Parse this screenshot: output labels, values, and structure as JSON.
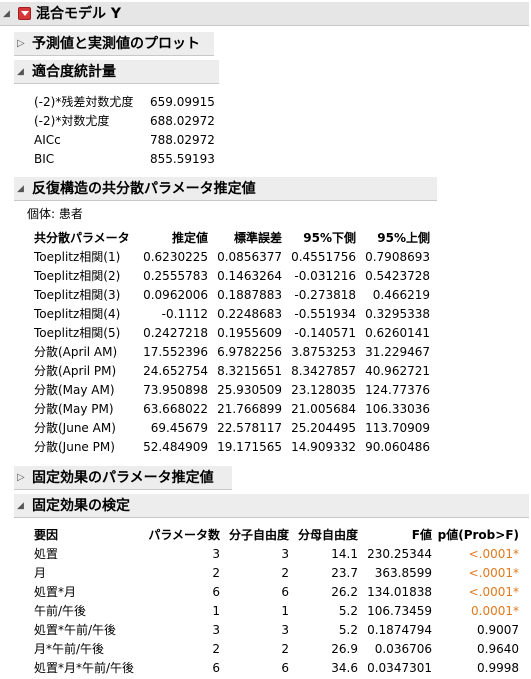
{
  "report": {
    "title": "混合モデル Y",
    "sections": {
      "pred_plot": "予測値と実測値のプロット",
      "fit_stats": "適合度統計量",
      "cov_params": "反復構造の共分散パラメータ推定値",
      "fixed_params": "固定効果のパラメータ推定値",
      "fixed_tests": "固定効果の検定"
    }
  },
  "fit_stats": [
    {
      "label": "(-2)*残差対数尤度",
      "value": "659.09915"
    },
    {
      "label": "(-2)*対数尤度",
      "value": "688.02972"
    },
    {
      "label": "AICc",
      "value": "788.02972"
    },
    {
      "label": "BIC",
      "value": "855.59193"
    }
  ],
  "subject": "個体: 患者",
  "cov_table": {
    "headers": [
      "共分散パラメータ",
      "推定値",
      "標準誤差",
      "95%下側",
      "95%上側"
    ],
    "rows": [
      [
        "Toeplitz相関(1)",
        "0.6230225",
        "0.0856377",
        "0.4551756",
        "0.7908693"
      ],
      [
        "Toeplitz相関(2)",
        "0.2555783",
        "0.1463264",
        "-0.031216",
        "0.5423728"
      ],
      [
        "Toeplitz相関(3)",
        "0.0962006",
        "0.1887883",
        "-0.273818",
        "0.466219"
      ],
      [
        "Toeplitz相関(4)",
        "-0.1112",
        "0.2248683",
        "-0.551934",
        "0.3295338"
      ],
      [
        "Toeplitz相関(5)",
        "0.2427218",
        "0.1955609",
        "-0.140571",
        "0.6260141"
      ],
      [
        "分散(April AM)",
        "17.552396",
        "6.9782256",
        "3.8753253",
        "31.229467"
      ],
      [
        "分散(April PM)",
        "24.652754",
        "8.3215651",
        "8.3427857",
        "40.962721"
      ],
      [
        "分散(May AM)",
        "73.950898",
        "25.930509",
        "23.128035",
        "124.77376"
      ],
      [
        "分散(May PM)",
        "63.668022",
        "21.766899",
        "21.005684",
        "106.33036"
      ],
      [
        "分散(June AM)",
        "69.45679",
        "22.578117",
        "25.204495",
        "113.70909"
      ],
      [
        "分散(June PM)",
        "52.484909",
        "19.171565",
        "14.909332",
        "90.060486"
      ]
    ]
  },
  "fixed_table": {
    "headers": [
      "要因",
      "パラメータ数",
      "分子自由度",
      "分母自由度",
      "F値",
      "p値(Prob>F)"
    ],
    "rows": [
      [
        "処置",
        "3",
        "3",
        "14.1",
        "230.25344",
        "<.0001*"
      ],
      [
        "月",
        "2",
        "2",
        "23.7",
        "363.8599",
        "<.0001*"
      ],
      [
        "処置*月",
        "6",
        "6",
        "26.2",
        "134.01838",
        "<.0001*"
      ],
      [
        "午前/午後",
        "1",
        "1",
        "5.2",
        "106.73459",
        "0.0001*"
      ],
      [
        "処置*午前/午後",
        "3",
        "3",
        "5.2",
        "0.1874794",
        "0.9007"
      ],
      [
        "月*午前/午後",
        "2",
        "2",
        "26.9",
        "0.036706",
        "0.9640"
      ],
      [
        "処置*月*午前/午後",
        "6",
        "6",
        "34.6",
        "0.0347301",
        "0.9998"
      ]
    ],
    "significant_color": "#e07a1f"
  }
}
